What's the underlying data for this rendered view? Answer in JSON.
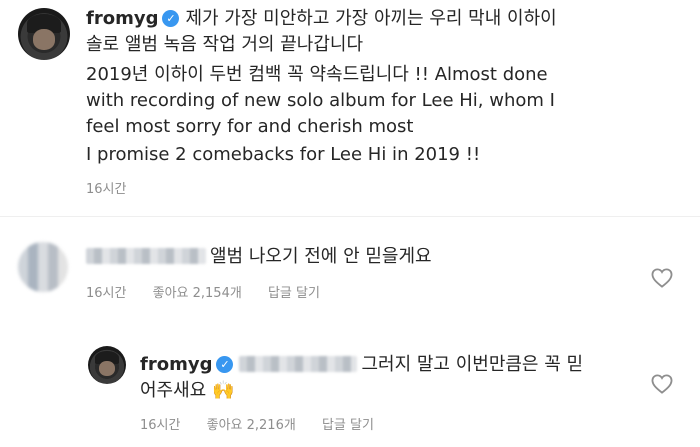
{
  "post": {
    "username": "fromyg",
    "caption_line1": "제가 가장 미안하고 가장 아끼는 우리 막내  이하이",
    "caption_line2": "솔로 앨범 녹음 작업 거의 끝나갑니다",
    "caption_line3": "2019년 이하이 두번 컴백 꼭 약속드립니다 !! Almost done",
    "caption_line4": "with recording of new solo album for Lee Hi, whom I",
    "caption_line5": "feel most sorry for and cherish most",
    "caption_line6": "I promise 2 comebacks for Lee Hi in 2019 !!",
    "time": "16시간"
  },
  "comment1": {
    "text": "앨범 나오기 전에 안 믿을게요",
    "time": "16시간",
    "likes": "좋아요 2,154개",
    "reply": "답글 달기"
  },
  "comment2": {
    "username": "fromyg",
    "text_line1": "그러지 말고 이번만큼은 꼭 믿",
    "text_line2": "어주새요 🙌",
    "time": "16시간",
    "likes": "좋아요 2,216개",
    "reply": "답글 달기"
  },
  "icons": {
    "verified": "verified-badge-icon",
    "heart": "heart-outline-icon"
  },
  "colors": {
    "verified": "#3897f0",
    "meta": "#8e8e8e",
    "text": "#262626"
  }
}
